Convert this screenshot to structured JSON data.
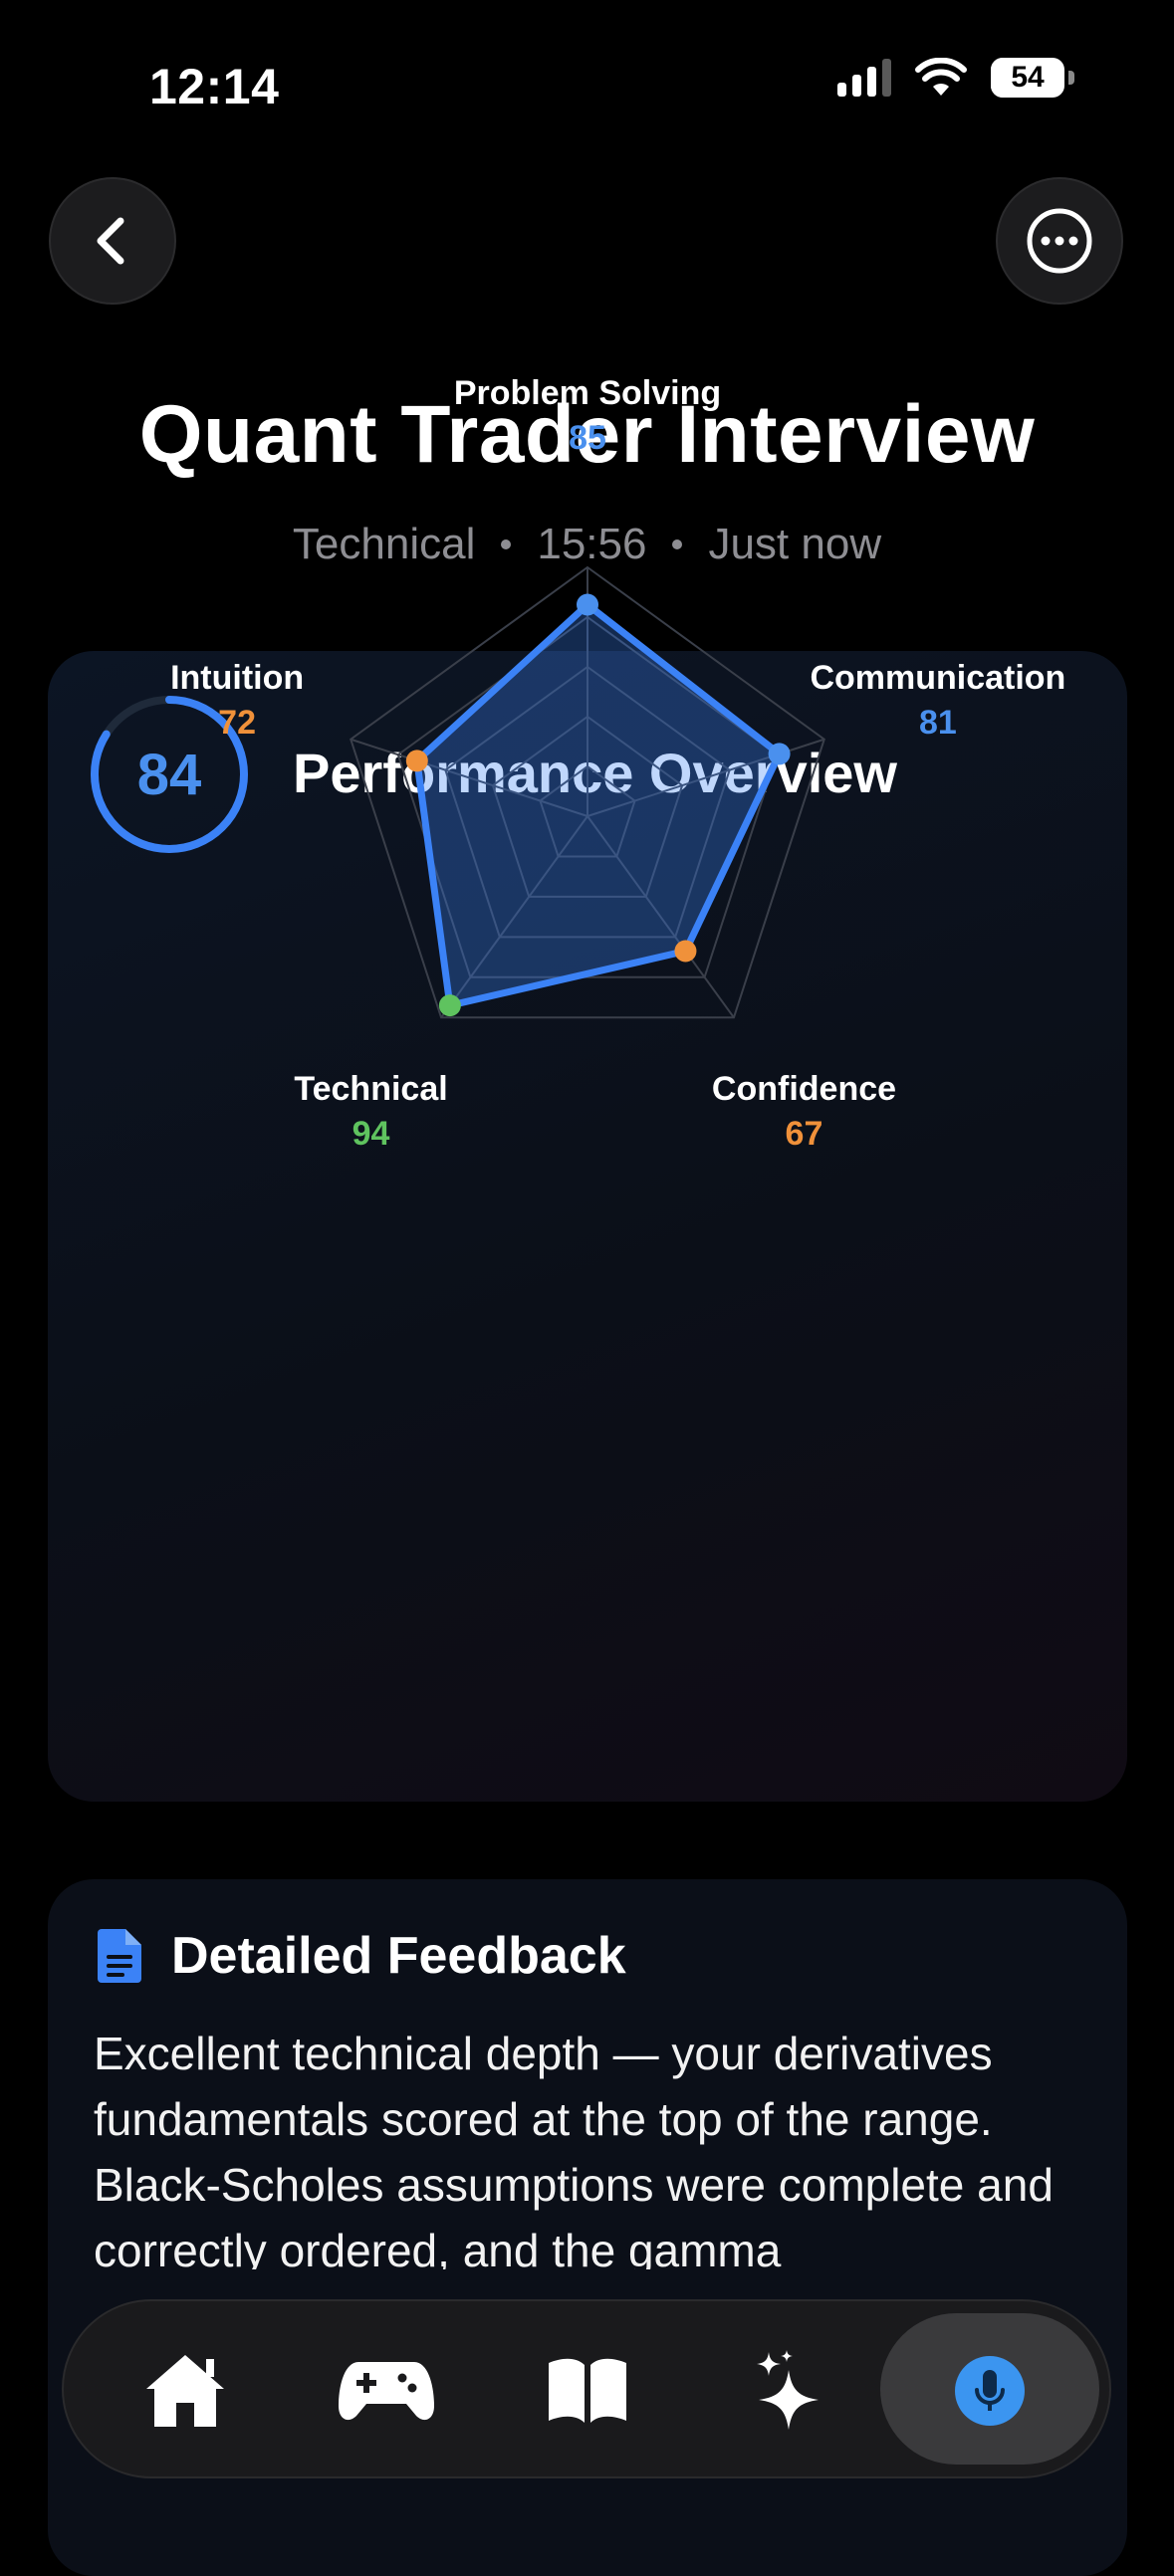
{
  "status_bar": {
    "time": "12:14",
    "battery": "54",
    "battery_level": 54
  },
  "header": {
    "title": "Quant Trader Interview",
    "meta": [
      "Technical",
      "15:56",
      "Just now"
    ]
  },
  "performance": {
    "title": "Performance Overview",
    "overall_score": "84",
    "overall_score_value": 84,
    "colors": {
      "accent": "#3b82f6",
      "good": "#5fc35f",
      "warn": "#f0913a"
    }
  },
  "chart_data": {
    "type": "radar",
    "range": [
      0,
      100
    ],
    "grid_levels": 5,
    "axes": [
      {
        "label": "Problem Solving",
        "value": 85,
        "value_text": "85",
        "color": "#4a90ee"
      },
      {
        "label": "Communication",
        "value": 81,
        "value_text": "81",
        "color": "#4a90ee"
      },
      {
        "label": "Confidence",
        "value": 67,
        "value_text": "67",
        "color": "#f0913a"
      },
      {
        "label": "Technical",
        "value": 94,
        "value_text": "94",
        "color": "#5fc35f"
      },
      {
        "label": "Intuition",
        "value": 72,
        "value_text": "72",
        "color": "#f0913a"
      }
    ]
  },
  "feedback": {
    "title": "Detailed Feedback",
    "text": "Excellent technical depth — your derivatives fundamentals scored at the top of the range. Black-Scholes assumptions were complete and correctly ordered, and the gamma"
  },
  "tab_bar": {
    "items": [
      {
        "name": "home-icon"
      },
      {
        "name": "gamepad-icon"
      },
      {
        "name": "book-icon"
      },
      {
        "name": "sparkles-icon"
      },
      {
        "name": "microphone-icon"
      }
    ]
  }
}
